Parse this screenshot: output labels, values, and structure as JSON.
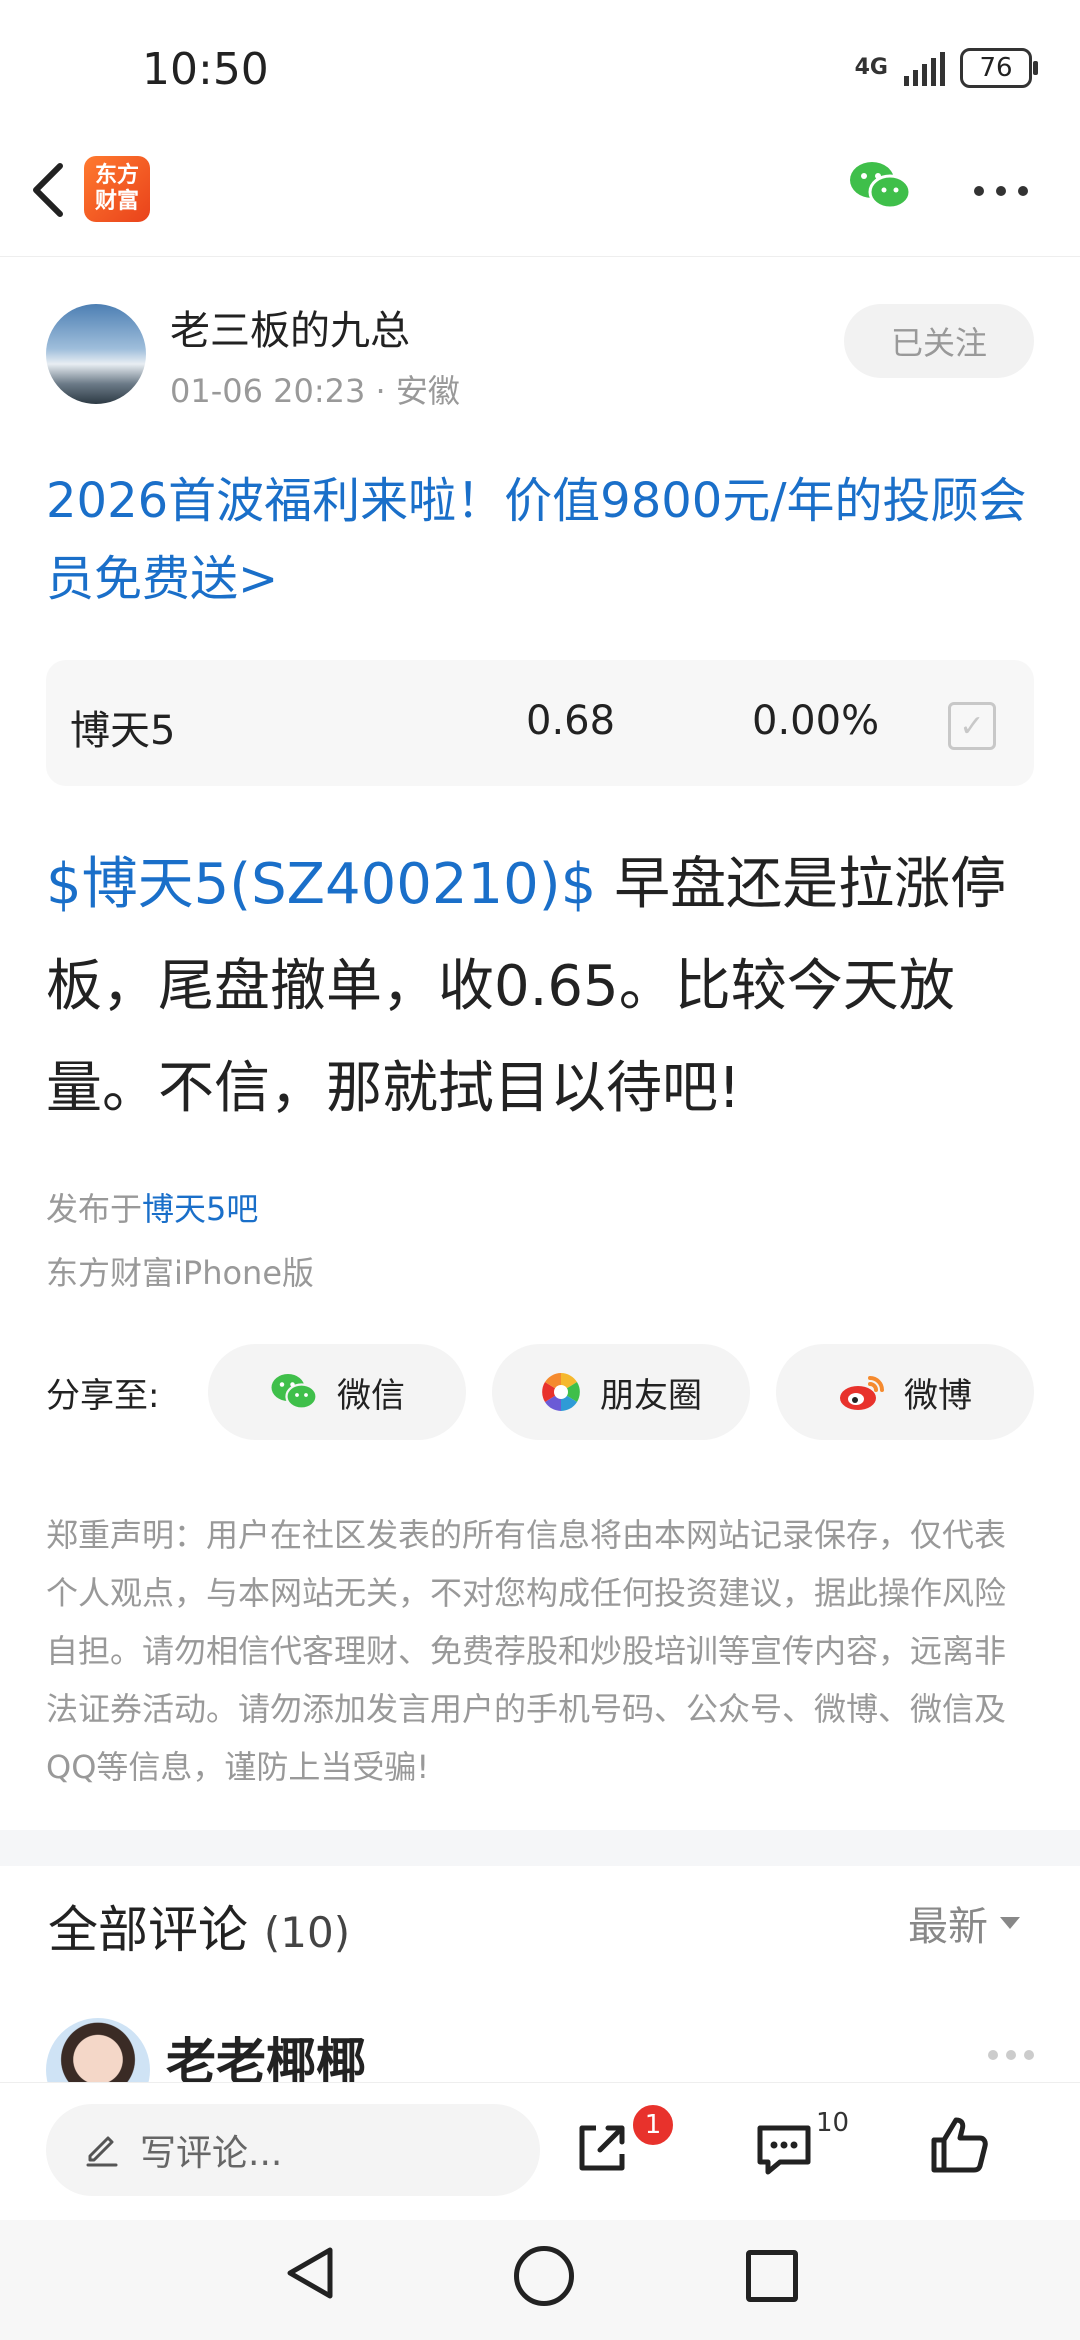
{
  "status_bar": {
    "time": "10:50",
    "network": "4G",
    "battery": "76"
  },
  "nav": {
    "logo_line1": "东方",
    "logo_line2": "财富"
  },
  "post": {
    "author": "老三板的九总",
    "date": "01-06 20:23",
    "location": "· 安徽",
    "follow_label": "已关注",
    "promo": "2026首波福利来啦！价值9800元/年的投顾会员免费送>",
    "stock": {
      "name": "博天5",
      "price": "0.68",
      "change": "0.00%"
    },
    "tag": "$博天5(SZ400210)$",
    "body": " 早盘还是拉涨停板，尾盘撤单，收0.65。比较今天放量。不信，那就拭目以待吧!",
    "published_prefix": "发布于",
    "bar_name": "博天5吧",
    "client": "东方财富iPhone版"
  },
  "share": {
    "label": "分享至:",
    "wechat": "微信",
    "moments": "朋友圈",
    "weibo": "微博"
  },
  "disclaimer": "郑重声明：用户在社区发表的所有信息将由本网站记录保存，仅代表个人观点，与本网站无关，不对您构成任何投资建议，据此操作风险自担。请勿相信代客理财、免费荐股和炒股培训等宣传内容，远离非法证券活动。请勿添加发言用户的手机号码、公众号、微博、微信及QQ等信息，谨防上当受骗!",
  "comments": {
    "title": "全部评论",
    "count": "(10)",
    "sort": "最新",
    "first_author": "老老椰椰"
  },
  "action_bar": {
    "placeholder": "写评论...",
    "share_badge": "1",
    "comment_count": "10"
  },
  "colors": {
    "accent": "#1a6fc9",
    "brand": "#e9421b",
    "wechat": "#3fbf4a",
    "badge": "#e8322c"
  }
}
